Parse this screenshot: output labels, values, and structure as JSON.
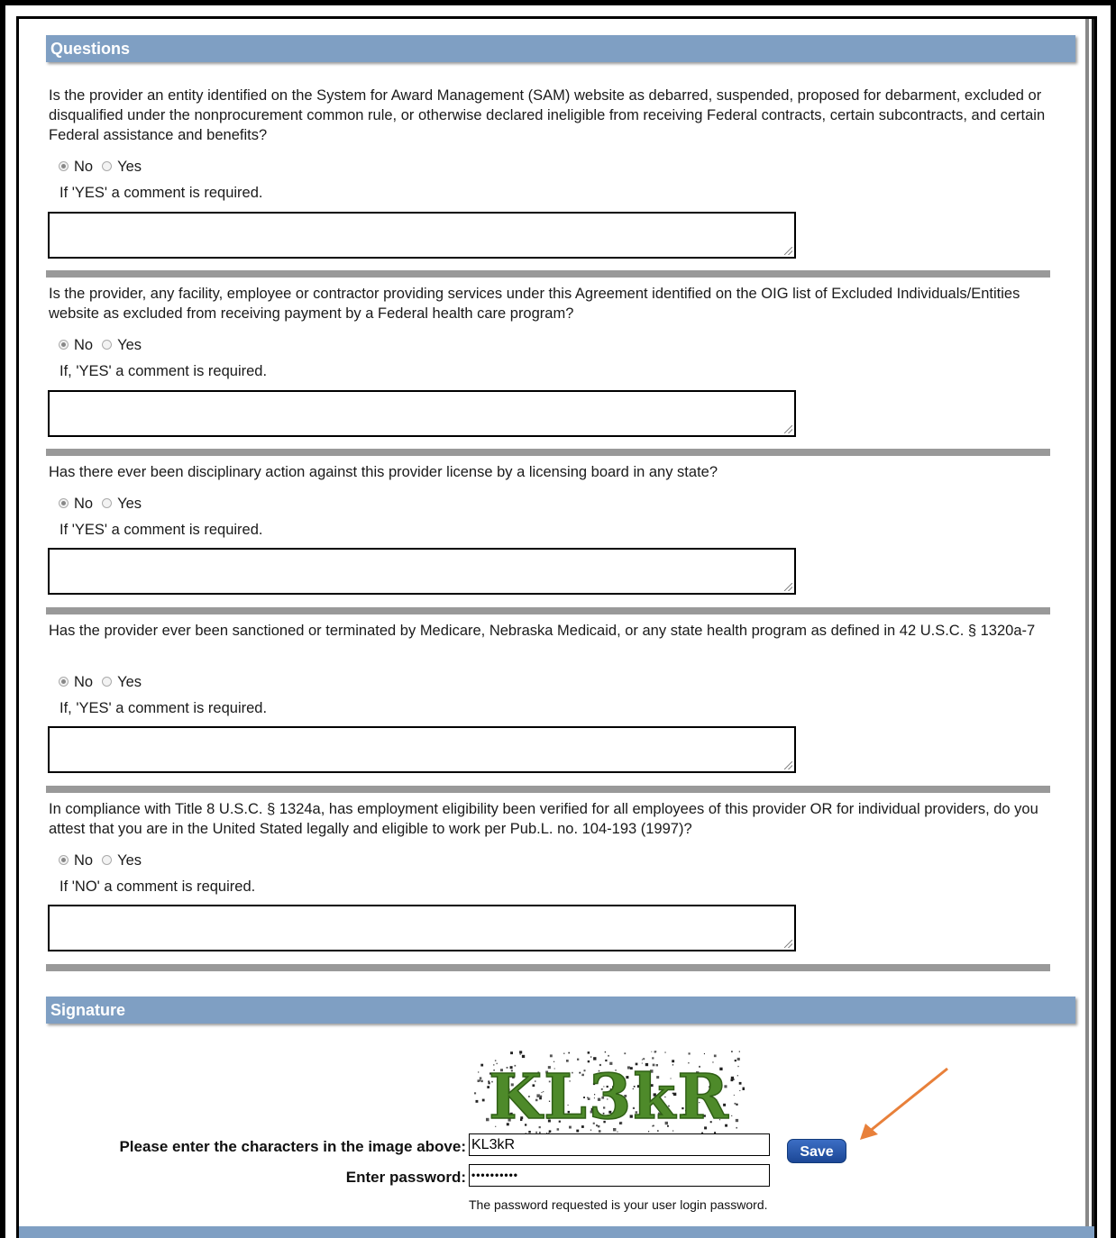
{
  "questions_section": {
    "title": "Questions",
    "items": [
      {
        "text": "Is the provider an entity identified on the System for Award Management (SAM) website as debarred, suspended, proposed for debarment, excluded or disqualified under the nonprocurement common rule, or otherwise declared ineligible from receiving Federal contracts, certain subcontracts, and certain Federal assistance and benefits?",
        "option_no": "No",
        "option_yes": "Yes",
        "selected": "No",
        "note": "If 'YES' a comment is required."
      },
      {
        "text": "Is the provider, any facility, employee or contractor providing services under this Agreement identified on the OIG list of Excluded Individuals/Entities website as excluded from receiving payment by a Federal health care program?",
        "option_no": "No",
        "option_yes": "Yes",
        "selected": "No",
        "note": "If, 'YES' a comment is required."
      },
      {
        "text": "Has there ever been disciplinary action against this provider license by a licensing board in any state?",
        "option_no": "No",
        "option_yes": "Yes",
        "selected": "No",
        "note": "If 'YES' a comment is required."
      },
      {
        "text": "Has the provider ever been sanctioned or terminated by Medicare, Nebraska Medicaid, or any state health program as defined in 42 U.S.C. § 1320a-7",
        "option_no": "No",
        "option_yes": "Yes",
        "selected": "No",
        "note": "If, 'YES' a comment is required."
      },
      {
        "text": "In compliance with Title 8 U.S.C. § 1324a, has employment eligibility been verified for all employees of this provider OR for individual providers, do you attest that you are in the United Stated legally and eligible to work per Pub.L. no. 104-193 (1997)?",
        "option_no": "No",
        "option_yes": "Yes",
        "selected": "No",
        "note": "If 'NO' a comment is required."
      }
    ]
  },
  "signature_section": {
    "title": "Signature",
    "captcha_text": "KL3kR",
    "captcha_label": "Please enter the characters in the image above:",
    "captcha_value": "KL3kR",
    "password_label": "Enter password:",
    "password_value": "••••••••••",
    "password_hint": "The password requested is your user login password.",
    "save_label": "Save"
  },
  "colors": {
    "header_bg": "#7f9fc3",
    "divider": "#999999",
    "save_button": "#1c4796",
    "annotation_arrow": "#e8803a",
    "captcha_green": "#4e8a2a"
  }
}
